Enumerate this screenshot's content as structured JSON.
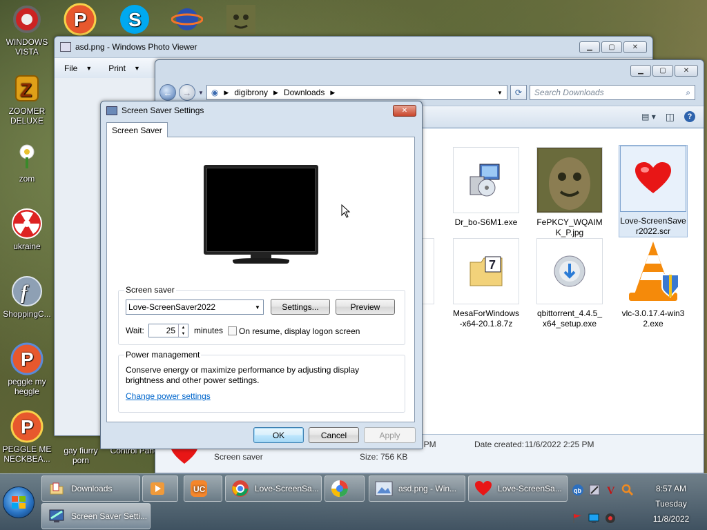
{
  "desktop": {
    "icons": [
      {
        "label": "WINDOWS\nVISTA"
      },
      {
        "label": "ZOOMER\nDELUXE"
      },
      {
        "label": "zom"
      },
      {
        "label": "ukraine"
      },
      {
        "label": "ShoppingC..."
      },
      {
        "label": "peggle my\nheggle"
      },
      {
        "label": "PEGGLE ME\nNECKBEA..."
      },
      {
        "label": "gay fiurry\nporn"
      },
      {
        "label": "Control Panel"
      }
    ]
  },
  "photo_viewer": {
    "title": "asd.png - Windows Photo Viewer",
    "menu": [
      {
        "label": "File"
      },
      {
        "label": "Print"
      }
    ]
  },
  "explorer": {
    "breadcrumb": [
      "digibrony",
      "Downloads"
    ],
    "search_placeholder": "Search Downloads",
    "files": [
      {
        "name": "Dr_bo-S6M1.exe",
        "icon": "installer-icon"
      },
      {
        "name": "FePKCY_WQAIMK_P.jpg",
        "icon": "tree-face-photo"
      },
      {
        "name": "Love-ScreenSaver2022.scr",
        "icon": "heart-icon"
      },
      {
        "name": "MesaForWindows-x64-20.1.8.7z",
        "icon": "7zip-archive-icon"
      },
      {
        "name": "qbittorrent_4.4.5_x64_setup.exe",
        "icon": "nsis-installer-icon"
      },
      {
        "name": "vlc-3.0.17.4-win32.exe",
        "icon": "vlc-cone-icon"
      }
    ],
    "partial_file_label": "ow",
    "details": {
      "modified_time_fragment": "25 PM",
      "date_created_label": "Date created:",
      "date_created_value": "11/6/2022 2:25 PM",
      "type": "Screen saver",
      "size_label": "Size:",
      "size_value": "756 KB"
    }
  },
  "ss_dialog": {
    "title": "Screen Saver Settings",
    "tab": "Screen Saver",
    "screen_saver_group": "Screen saver",
    "selected_screensaver": "Love-ScreenSaver2022",
    "settings_button": "Settings...",
    "preview_button": "Preview",
    "wait_label": "Wait:",
    "wait_value": "25",
    "minutes_label": "minutes",
    "resume_label": "On resume, display logon screen",
    "power_group": "Power management",
    "power_text": "Conserve energy or maximize performance by adjusting display brightness and other power settings.",
    "power_link": "Change power settings",
    "ok": "OK",
    "cancel": "Cancel",
    "apply": "Apply"
  },
  "taskbar": {
    "buttons": [
      {
        "label": "Downloads"
      },
      {
        "label": "Love-ScreenSa..."
      },
      {
        "label": "asd.png - Win..."
      },
      {
        "label": "Love-ScreenSa..."
      },
      {
        "label": "Screen Saver Setti..."
      }
    ],
    "clock": {
      "time": "8:57 AM",
      "day": "Tuesday",
      "date": "11/8/2022"
    }
  },
  "colors": {
    "accent": "#3c7fb1",
    "link": "#0066cc"
  }
}
